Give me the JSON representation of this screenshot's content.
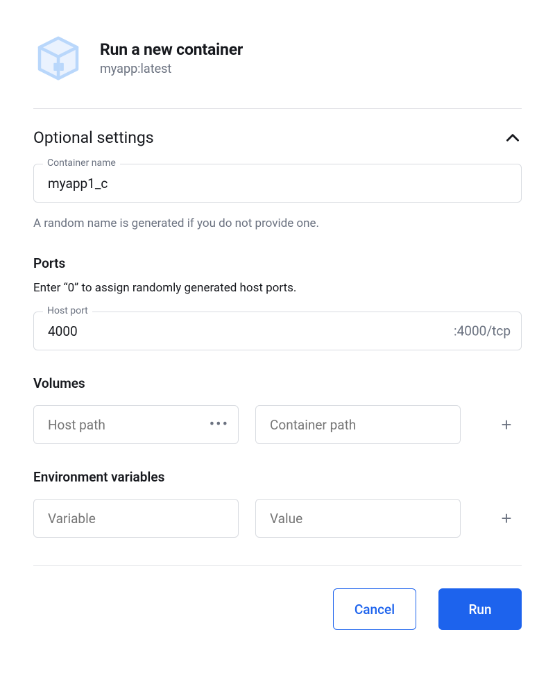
{
  "header": {
    "title": "Run a new container",
    "subtitle": "myapp:latest"
  },
  "optional": {
    "heading": "Optional settings",
    "container_name_label": "Container name",
    "container_name_value": "myapp1_c",
    "container_name_helper": "A random name is generated if you do not provide one."
  },
  "ports": {
    "heading": "Ports",
    "helper": "Enter “0” to assign randomly generated host ports.",
    "host_port_label": "Host port",
    "host_port_value": "4000",
    "suffix": ":4000/tcp"
  },
  "volumes": {
    "heading": "Volumes",
    "host_path_placeholder": "Host path",
    "container_path_placeholder": "Container path"
  },
  "env": {
    "heading": "Environment variables",
    "variable_placeholder": "Variable",
    "value_placeholder": "Value"
  },
  "footer": {
    "cancel_label": "Cancel",
    "run_label": "Run"
  }
}
